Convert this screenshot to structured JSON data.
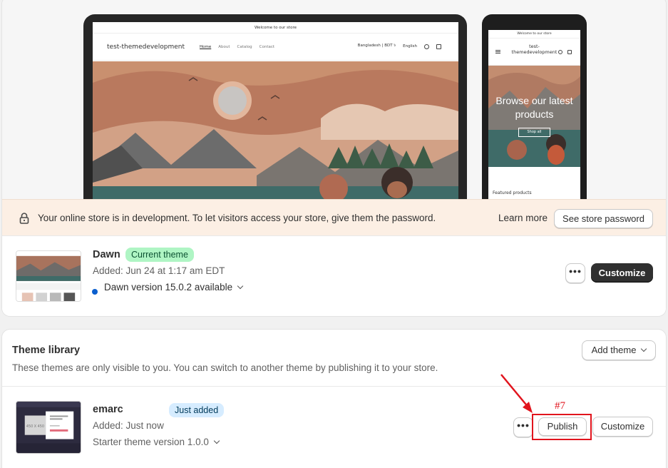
{
  "preview": {
    "laptop": {
      "announcement": "Welcome to our store",
      "site_title": "test-themedevelopment",
      "nav": [
        "Home",
        "About",
        "Catalog",
        "Contact"
      ],
      "currency": "Bangladesh | BDT ৳",
      "language": "English"
    },
    "phone": {
      "announcement": "Welcome to our store",
      "site_title": "test-themedevelopment",
      "hero_heading": "Browse our latest products",
      "shop_all": "Shop all",
      "featured": "Featured products"
    }
  },
  "banner": {
    "text": "Your online store is in development. To let visitors access your store, give them the password.",
    "learn_more": "Learn more",
    "see_password": "See store password",
    "icon": "lock-icon"
  },
  "current_theme": {
    "name": "Dawn",
    "badge": "Current theme",
    "added": "Added: Jun 24 at 1:17 am EDT",
    "version": "Dawn version 15.0.2 available",
    "more": "•••",
    "customize": "Customize"
  },
  "library": {
    "title": "Theme library",
    "description": "These themes are only visible to you. You can switch to another theme by publishing it to your store.",
    "add_theme": "Add theme",
    "themes": [
      {
        "name": "emarc",
        "badge": "Just added",
        "added": "Added: Just now",
        "version": "Starter theme version 1.0.0",
        "more": "•••",
        "publish": "Publish",
        "customize": "Customize"
      }
    ]
  },
  "annotation": {
    "label": "#7",
    "color": "#e1141d"
  },
  "colors": {
    "dark_button": "#303030",
    "badge_green": "#aff5c4",
    "badge_blue": "#d6ecff",
    "banner_bg": "#fcefe4",
    "status_dot": "#0b5fce"
  }
}
